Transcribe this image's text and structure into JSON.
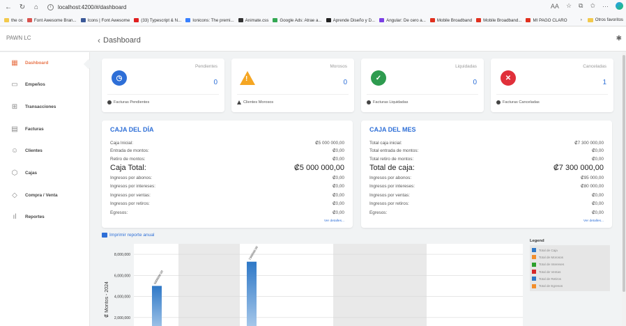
{
  "browser": {
    "url": "localhost:4200/#/dashboard",
    "zoom_badge": "AA",
    "bookmarks": [
      {
        "label": "the oc",
        "color": "#f2c94c"
      },
      {
        "label": "Font Awesome Bran...",
        "color": "#d9534f"
      },
      {
        "label": "Icons | Font Awesome",
        "color": "#3b5998"
      },
      {
        "label": "(33) Typescript & N...",
        "color": "#e02020"
      },
      {
        "label": "Ionicons: The premi...",
        "color": "#3880ff"
      },
      {
        "label": "Animate.css",
        "color": "#333333"
      },
      {
        "label": "Google Ads: Atrae a...",
        "color": "#34a853"
      },
      {
        "label": "Aprende Diseño y D...",
        "color": "#222222"
      },
      {
        "label": "Angular: De cero a...",
        "color": "#7b3fe4"
      },
      {
        "label": "Mobile Broadband",
        "color": "#e0301e"
      },
      {
        "label": "Mobile Broadband...",
        "color": "#e0301e"
      },
      {
        "label": "MI PAGO CLARO",
        "color": "#e0301e"
      }
    ],
    "other_favorites": "Otros favoritos"
  },
  "app": {
    "brand": "PAWN LC",
    "breadcrumb": "Dashboard"
  },
  "sidebar": {
    "items": [
      {
        "label": "Dashboard",
        "icon": "grid-icon",
        "glyph": "▦"
      },
      {
        "label": "Empeños",
        "icon": "credit-card-icon",
        "glyph": "▭"
      },
      {
        "label": "Transacciones",
        "icon": "plus-square-icon",
        "glyph": "⊞"
      },
      {
        "label": "Facturas",
        "icon": "document-icon",
        "glyph": "▤"
      },
      {
        "label": "Clientes",
        "icon": "users-icon",
        "glyph": "☺"
      },
      {
        "label": "Cajas",
        "icon": "box-icon",
        "glyph": "⬡"
      },
      {
        "label": "Compra / Venta",
        "icon": "tag-icon",
        "glyph": "◇"
      },
      {
        "label": "Reportes",
        "icon": "bar-chart-icon",
        "glyph": "ıl"
      }
    ]
  },
  "stats": [
    {
      "label": "Pendientes",
      "value": "0",
      "footer": "Facturas Pendientes",
      "color": "#2e6fd7",
      "glyph": "◷",
      "foot_icon": "circle"
    },
    {
      "label": "Morosos",
      "value": "0",
      "footer": "Clientes Morosos",
      "color": "#f5a623",
      "glyph": "!",
      "foot_icon": "triangle"
    },
    {
      "label": "Liquidadas",
      "value": "0",
      "footer": "Facturas Liquidadas",
      "color": "#2e9b4f",
      "glyph": "✓",
      "foot_icon": "circle"
    },
    {
      "label": "Canceladas",
      "value": "1",
      "footer": "Facturas Canceladas",
      "color": "#e0303a",
      "glyph": "✕",
      "foot_icon": "circle"
    }
  ],
  "caja_dia": {
    "title": "CAJA DEL DÍA",
    "rows": [
      {
        "label": "Caja Inicial:",
        "value": "₡5 000 000,00"
      },
      {
        "label": "Entrada de montos:",
        "value": "₡0,00"
      },
      {
        "label": "Retiro de montos:",
        "value": "₡0,00"
      }
    ],
    "total": {
      "label": "Caja Total:",
      "value": "₡5 000 000,00"
    },
    "details": [
      {
        "label": "Ingresos por abonos:",
        "value": "₡0,00"
      },
      {
        "label": "Ingresos por intereses:",
        "value": "₡0,00"
      },
      {
        "label": "Ingresos por ventas:",
        "value": "₡0,00"
      },
      {
        "label": "Ingresos por retiros:",
        "value": "₡0,00"
      },
      {
        "label": "Egresos:",
        "value": "₡0,00"
      }
    ],
    "link": "Ver detalles..."
  },
  "caja_mes": {
    "title": "CAJA DEL MES",
    "rows": [
      {
        "label": "Total caja inicial:",
        "value": "₡7 300 000,00"
      },
      {
        "label": "Total entrada de montos:",
        "value": "₡0,00"
      },
      {
        "label": "Total retiro de montos:",
        "value": "₡0,00"
      }
    ],
    "total": {
      "label": "Total de caja:",
      "value": "₡7 300 000,00"
    },
    "details": [
      {
        "label": "Ingresos por abonos:",
        "value": "₡95 000,00"
      },
      {
        "label": "Ingresos por intereses:",
        "value": "₡80 000,00"
      },
      {
        "label": "Ingresos por ventas:",
        "value": "₡0,00"
      },
      {
        "label": "Ingresos por retiros:",
        "value": "₡0,00"
      },
      {
        "label": "Egresos:",
        "value": "₡0,00"
      }
    ],
    "link": "Ver detalles..."
  },
  "report": {
    "print_label": "Imprimir reporte anual"
  },
  "chart_data": {
    "type": "bar",
    "ylabel": "₡ Montos - 2024",
    "yticks": [
      2000000,
      4000000,
      6000000,
      8000000
    ],
    "ytick_labels": [
      "2,000,000",
      "4,000,000",
      "6,000,000",
      "8,000,000"
    ],
    "ylim": [
      0,
      9000000
    ],
    "grid": "alternating-bands",
    "legend_title": "Legend",
    "legend_position": "top-right",
    "series": [
      {
        "name": "Total de Caja",
        "color": "#2e78c7"
      },
      {
        "name": "Total de Morosos",
        "color": "#f28e2b"
      },
      {
        "name": "Total de Intereses",
        "color": "#2ca02c"
      },
      {
        "name": "Total de Ventas",
        "color": "#d62728"
      },
      {
        "name": "Total de Retiros",
        "color": "#2e78c7"
      },
      {
        "name": "Total de Egresos",
        "color": "#f28e2b"
      }
    ],
    "bars": [
      {
        "month_index": 0,
        "value": 5000000,
        "label": "5000000.00"
      },
      {
        "month_index": 1,
        "value": 7300000,
        "label": "7300000.00"
      }
    ]
  }
}
